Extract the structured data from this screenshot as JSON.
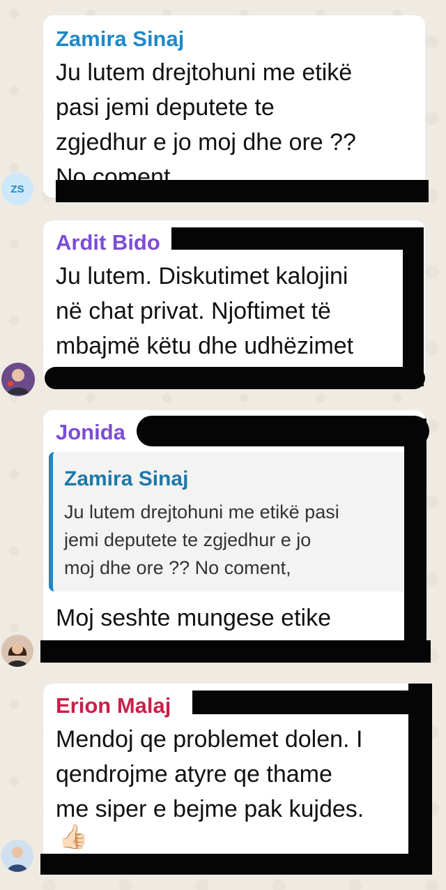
{
  "messages": [
    {
      "sender": "Zamira Sinaj",
      "sender_color": "#1e88c8",
      "avatar_initials": "ZS",
      "lines": [
        "Ju lutem drejtohuni me etikë",
        "pasi jemi deputete te",
        "zgjedhur e jo moj dhe ore ??",
        "No coment,"
      ]
    },
    {
      "sender": "Ardit Bido",
      "sender_color": "#7c4dd6",
      "lines": [
        "Ju lutem. Diskutimet kalojini",
        "në chat privat. Njoftimet të",
        "mbajmë këtu dhe udhëzimet"
      ]
    },
    {
      "sender": "Jonida",
      "sender_color": "#7c4dd6",
      "quote": {
        "sender": "Zamira Sinaj",
        "lines": [
          "Ju lutem drejtohuni me etikë pasi",
          "jemi deputete te zgjedhur e jo",
          "moj dhe ore ?? No coment,"
        ]
      },
      "lines": [
        "Moj seshte mungese etike"
      ]
    },
    {
      "sender": "Erion Malaj",
      "sender_color": "#c8204a",
      "lines": [
        "Mendoj qe problemet dolen. I",
        "qendrojme atyre qe thame",
        "me siper e bejme pak kujdes."
      ],
      "reaction": "👍🏻"
    }
  ]
}
